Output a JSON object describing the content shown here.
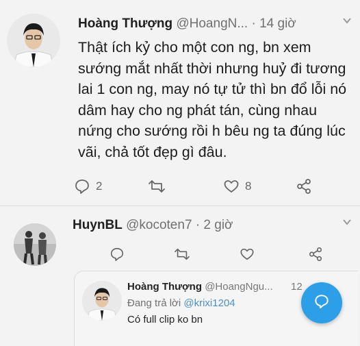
{
  "tweet1": {
    "author_name": "Hoàng Thượng",
    "handle": "@HoangN...",
    "separator": "·",
    "time": "14 giờ",
    "text": "Thật ích kỷ cho một con ng, bn xem sướng mắt nhất thời nhưng huỷ đi tương lai 1 con ng, may nó tự tử thì bn đổ lỗi nó dâm hay cho ng phát tán, cùng nhau nứng cho sướng rồi h bêu ng ta đúng lúc vãi, chả tốt đẹp gì đâu.",
    "reply_count": "2",
    "like_count": "8"
  },
  "tweet2": {
    "author_name": "HuynBL",
    "handle": "@kocoten7",
    "separator": "·",
    "time": "2 giờ",
    "quoted": {
      "author_name": "Hoàng Thượng",
      "handle": "@HoangNgu...",
      "date": "12",
      "replying_prefix": "Đang trả lời",
      "replying_to": "@krixi1204",
      "text": "Có full clip ko bn"
    }
  },
  "icons": {
    "reply": "reply-icon",
    "retweet": "retweet-icon",
    "like": "heart-icon",
    "share": "share-icon",
    "more": "chevron-down-icon",
    "compose": "compose-icon"
  },
  "colors": {
    "accent": "#2d9ee8",
    "mention": "#4a8fc7",
    "muted": "#707070"
  }
}
